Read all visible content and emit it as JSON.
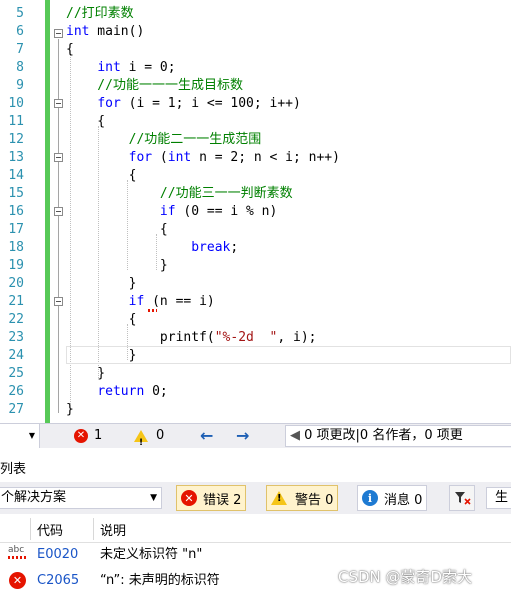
{
  "editor": {
    "lines": [
      {
        "num": "5",
        "text": "//打印素数"
      },
      {
        "num": "6",
        "text": "int main()"
      },
      {
        "num": "7",
        "text": "{"
      },
      {
        "num": "8",
        "text": "    int i = 0;"
      },
      {
        "num": "9",
        "text": "    //功能一一一生成目标数"
      },
      {
        "num": "10",
        "text": "    for (i = 1; i <= 100; i++)"
      },
      {
        "num": "11",
        "text": "    {"
      },
      {
        "num": "12",
        "text": "        //功能二一一生成范围"
      },
      {
        "num": "13",
        "text": "        for (int n = 2; n < i; n++)"
      },
      {
        "num": "14",
        "text": "        {"
      },
      {
        "num": "15",
        "text": "            //功能三一一判断素数"
      },
      {
        "num": "16",
        "text": "            if (0 == i % n)"
      },
      {
        "num": "17",
        "text": "            {"
      },
      {
        "num": "18",
        "text": "                break;"
      },
      {
        "num": "19",
        "text": "            }"
      },
      {
        "num": "20",
        "text": "        }"
      },
      {
        "num": "21",
        "text": "        if (n == i)"
      },
      {
        "num": "22",
        "text": "        {"
      },
      {
        "num": "23",
        "text": "            printf(\"%-2d  \", i);"
      },
      {
        "num": "24",
        "text": "        }"
      },
      {
        "num": "25",
        "text": "    }"
      },
      {
        "num": "26",
        "text": "    return 0;"
      },
      {
        "num": "27",
        "text": "}"
      }
    ]
  },
  "statusbar": {
    "error_count": "1",
    "warning_count": "0",
    "back_arrow": "←",
    "forward_arrow": "→",
    "changes_text": "0 项更改|0 名作者，0 项更"
  },
  "error_list": {
    "title": "列表",
    "scope": "个解决方案",
    "errors_label": "错误 2",
    "warnings_label": "警告 0",
    "messages_label": "消息 0",
    "build_label": "生",
    "columns": {
      "code": "代码",
      "description": "说明"
    },
    "rows": [
      {
        "code": "E0020",
        "description": "未定义标识符 \"n\""
      },
      {
        "code": "C2065",
        "description": "“n”: 未声明的标识符"
      }
    ]
  },
  "watermark": "CSDN @蒙奇D索大",
  "colors": {
    "keyword": "#0000ff",
    "comment": "#008000",
    "string": "#a31515",
    "line_number": "#2b91af",
    "changed_bar": "#57c957",
    "error": "#e51400"
  }
}
